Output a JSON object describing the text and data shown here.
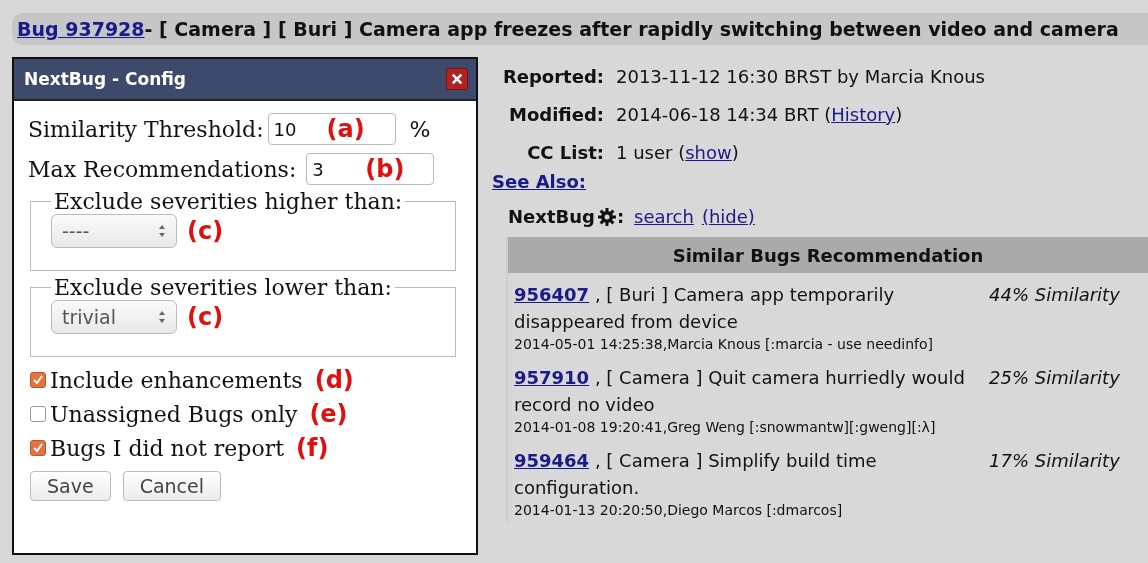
{
  "header": {
    "bug_link": "Bug 937928",
    "title": " - [ Camera ] [ Buri ] Camera app freezes after rapidly switching between video and camera"
  },
  "dialog": {
    "title": "NextBug - Config",
    "fields": [
      {
        "label": "Similarity Threshold:",
        "value": "10",
        "annotation": "(a)",
        "suffix": "%"
      },
      {
        "label": "Max Recommendations:",
        "value": "3",
        "annotation": "(b)"
      }
    ],
    "severity_groups": [
      {
        "legend": "Exclude severities higher than:",
        "value": "----",
        "annotation": "(c)"
      },
      {
        "legend": "Exclude severities lower than:",
        "value": "trivial",
        "annotation": "(c)"
      }
    ],
    "checkboxes": [
      {
        "label": "Include enhancements",
        "checked": true,
        "annotation": "(d)"
      },
      {
        "label": "Unassigned Bugs only",
        "checked": false,
        "annotation": "(e)"
      },
      {
        "label": "Bugs I did not report",
        "checked": true,
        "annotation": "(f)"
      }
    ],
    "buttons": [
      "Save",
      "Cancel"
    ]
  },
  "details": [
    {
      "label": "Reported:",
      "value": "2013-11-12 16:30 BRST by Marcia Knous"
    },
    {
      "label": "Modified:",
      "value": "2014-06-18 14:34 BRT (",
      "link": "History",
      "after": ")"
    },
    {
      "label": "CC List:",
      "value": "1 user (",
      "link": "show",
      "after": ")"
    }
  ],
  "see_also": "See Also:",
  "nextbug": {
    "label": "NextBug",
    "colon": ":",
    "search": "search",
    "hide": "(hide)"
  },
  "recommendations": {
    "heading": "Similar Bugs Recommendation",
    "items": [
      {
        "id": "956407",
        "title": " , [ Buri ] Camera app temporarily disappeared from device",
        "similarity": "44% Similarity",
        "meta": "2014-05-01 14:25:38,Marcia Knous [:marcia - use needinfo]"
      },
      {
        "id": "957910",
        "title": " , [ Camera ] Quit camera hurriedly would record no video",
        "similarity": "25% Similarity",
        "meta": "2014-01-08 19:20:41,Greg Weng [:snowmantw][:gweng][:λ]"
      },
      {
        "id": "959464",
        "title": " , [ Camera ] Simplify build time configuration.",
        "similarity": "17% Similarity",
        "meta": "2014-01-13 20:20:50,Diego Marcos [:dmarcos]"
      }
    ]
  }
}
